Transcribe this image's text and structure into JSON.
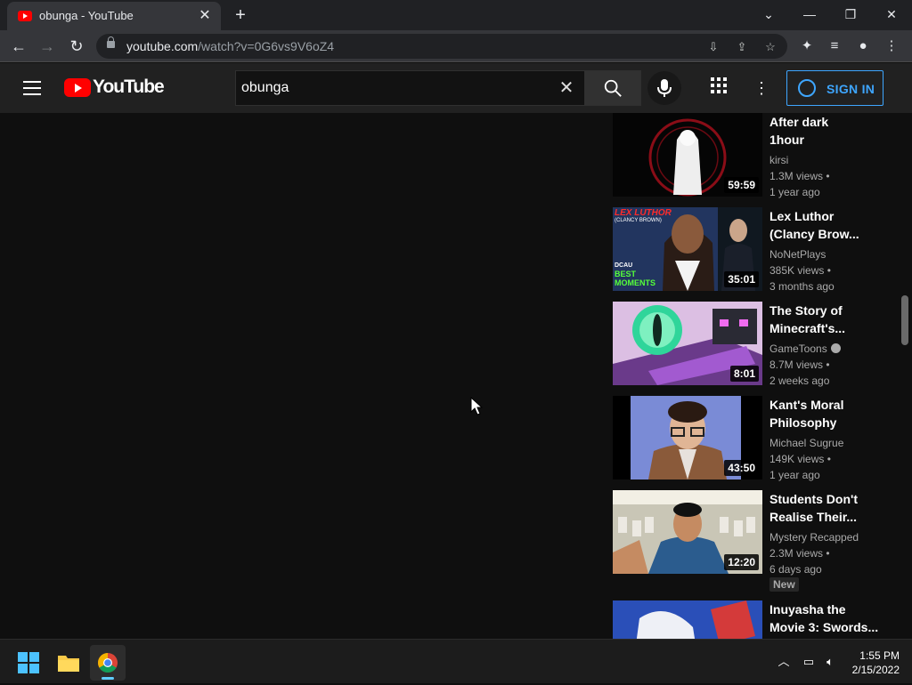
{
  "browser": {
    "tab_title": "obunga - YouTube",
    "url_host": "youtube.com",
    "url_path": "/watch?v=0G6vs9V6oZ4"
  },
  "youtube": {
    "logo_text": "YouTube",
    "search_value": "obunga",
    "sign_in_label": "SIGN IN"
  },
  "recommendations": [
    {
      "title_line1": "After dark",
      "title_line2": "1hour",
      "channel": "kirsi",
      "views": "1.3M views •",
      "age": "1 year ago",
      "duration": "59:59",
      "verified": false
    },
    {
      "title_line1": "Lex Luthor",
      "title_line2": "(Clancy Brow...",
      "channel": "NoNetPlays",
      "views": "385K views •",
      "age": "3 months ago",
      "duration": "35:01",
      "verified": false
    },
    {
      "title_line1": "The Story of",
      "title_line2": "Minecraft's...",
      "channel": "GameToons",
      "views": "8.7M views •",
      "age": "2 weeks ago",
      "duration": "8:01",
      "verified": true
    },
    {
      "title_line1": "Kant's Moral",
      "title_line2": "Philosophy",
      "channel": "Michael Sugrue",
      "views": "149K views •",
      "age": "1 year ago",
      "duration": "43:50",
      "verified": false
    },
    {
      "title_line1": "Students Don't",
      "title_line2": "Realise Their...",
      "channel": "Mystery Recapped",
      "views": "2.3M views •",
      "age": "6 days ago",
      "duration": "12:20",
      "verified": false,
      "badge": "New"
    },
    {
      "title_line1": "Inuyasha the",
      "title_line2": "Movie 3: Swords...",
      "channel": "",
      "views": "",
      "age": "",
      "duration": "",
      "verified": false
    }
  ],
  "thumb_text": {
    "lex_line1": "LEX LUTHOR",
    "lex_line2": "(CLANCY BROWN)",
    "lex_line3": "DCAU",
    "lex_line4": "BEST",
    "lex_line5": "MOMENTS"
  },
  "taskbar": {
    "time": "1:55 PM",
    "date": "2/15/2022"
  },
  "colors": {
    "accent_blue": "#3ea6ff",
    "yt_red": "#ff0000",
    "bg": "#0f0f0f"
  }
}
